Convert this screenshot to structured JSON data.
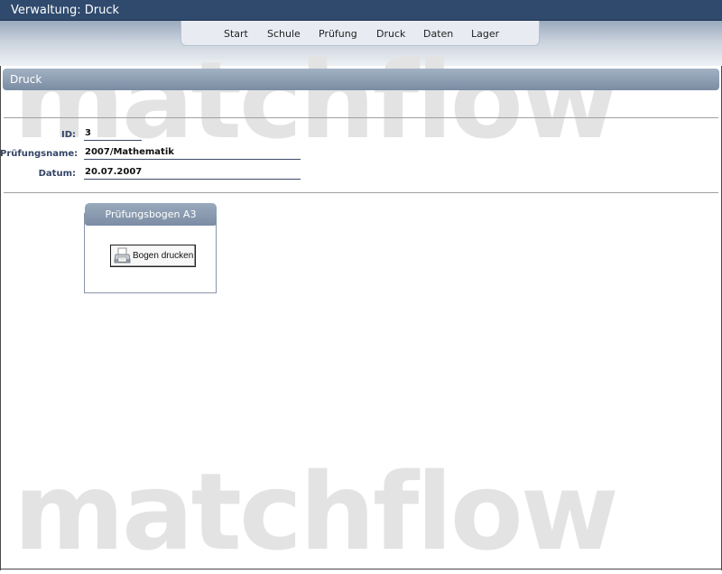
{
  "window": {
    "title": "Verwaltung: Druck"
  },
  "nav": {
    "items": [
      {
        "label": "Start"
      },
      {
        "label": "Schule"
      },
      {
        "label": "Prüfung"
      },
      {
        "label": "Druck"
      },
      {
        "label": "Daten"
      },
      {
        "label": "Lager"
      }
    ]
  },
  "watermark": {
    "text": "matchflow"
  },
  "panel": {
    "title": "Druck"
  },
  "form": {
    "id": {
      "label": "ID:",
      "value": "3"
    },
    "name": {
      "label": "Prüfungsname:",
      "value": "2007/Mathematik"
    },
    "date": {
      "label": "Datum:",
      "value": "20.07.2007"
    }
  },
  "group": {
    "title": "Prüfungsbogen A3",
    "button": {
      "label": "Bogen drucken",
      "icon": "printer-icon"
    }
  },
  "colors": {
    "titlebar": "#2f4a6d",
    "header": "#8797ac",
    "label": "#334466"
  }
}
